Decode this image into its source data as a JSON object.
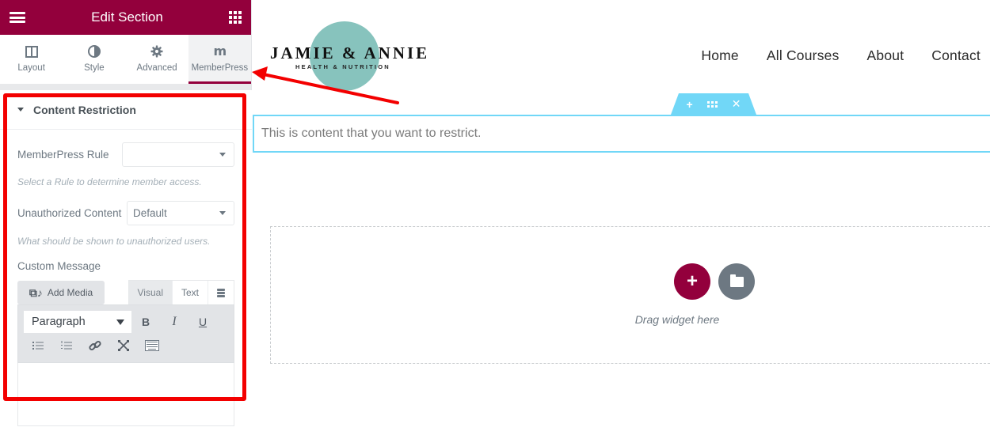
{
  "panel": {
    "title": "Edit Section",
    "header_icons": {
      "left": "hamburger-menu-icon",
      "right": "apps-grid-icon"
    },
    "tabs": [
      {
        "label": "Layout",
        "icon": "columns-layout-icon",
        "active": false
      },
      {
        "label": "Style",
        "icon": "half-circle-style-icon",
        "active": false
      },
      {
        "label": "Advanced",
        "icon": "gear-icon",
        "active": false
      },
      {
        "label": "MemberPress",
        "icon": "memberpress-m-icon",
        "active": true
      }
    ],
    "section": {
      "title": "Content Restriction",
      "expanded": true,
      "rule": {
        "label": "MemberPress Rule",
        "value": "",
        "help": "Select a Rule to determine member access."
      },
      "unauthorized": {
        "label": "Unauthorized Content",
        "value": "Default",
        "help": "What should be shown to unauthorized users."
      },
      "custom_message": {
        "label": "Custom Message",
        "add_media_label": "Add Media",
        "mode_tabs": [
          {
            "label": "Visual",
            "active": true
          },
          {
            "label": "Text",
            "active": false
          }
        ],
        "format_value": "Paragraph",
        "toolbar": {
          "bold": "B",
          "italic": "I",
          "underline": "U"
        },
        "content": ""
      }
    }
  },
  "preview": {
    "logo": {
      "name": "JAMIE & ANNIE",
      "tagline": "HEALTH & NUTRITION"
    },
    "nav": [
      "Home",
      "All Courses",
      "About",
      "Contact"
    ],
    "section_handle": {
      "add": "+",
      "close": "✕"
    },
    "restricted_text": "This is content that you want to restrict.",
    "drop_zone": {
      "add_button": "+",
      "text": "Drag widget here"
    }
  },
  "colors": {
    "brand": "#93003c",
    "section_outline": "#71d7f7",
    "annotation_red": "#f30000",
    "logo_circle": "#87c3bd"
  }
}
